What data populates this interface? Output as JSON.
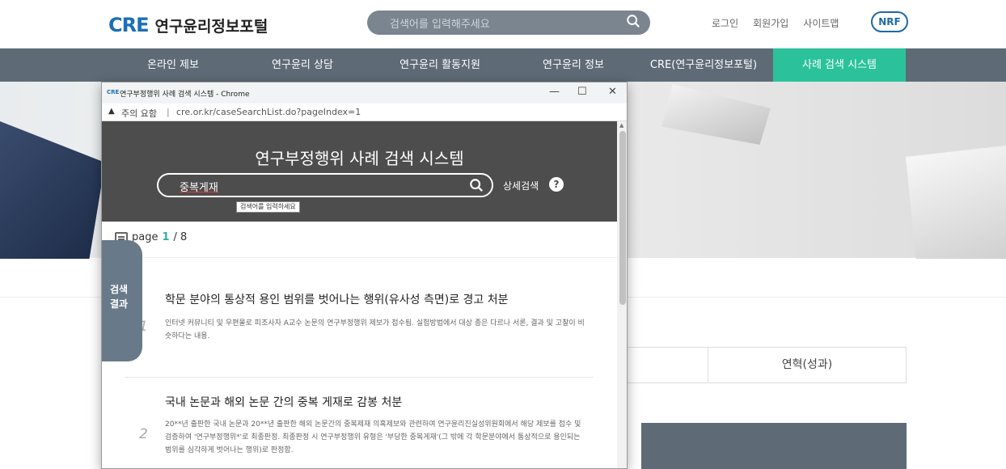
{
  "site": {
    "logo_mark": "CRE",
    "logo_text": "연구윤리정보포털",
    "search_placeholder": "검색어를 입력해주세요",
    "links": [
      "로그인",
      "회원가입",
      "사이트맵"
    ],
    "nrf_badge": "NRF"
  },
  "nav": {
    "items": [
      "온라인 제보",
      "연구윤리 상담",
      "연구윤리 활동지원",
      "연구윤리 정보",
      "CRE(연구윤리정보포털)",
      "사례 검색 시스템"
    ],
    "active_index": 5
  },
  "background": {
    "table_cell": "연혁(성과)"
  },
  "popup": {
    "window_title": "연구부정행위 사례 검색 시스템 - Chrome",
    "favicon_text": "CRE",
    "controls": [
      "—",
      "☐",
      "✕"
    ],
    "address": {
      "warning_icon": "▲",
      "warning_label": "주의 요함",
      "separator": "|",
      "url": "cre.or.kr/caseSearchList.do?pageIndex=1"
    },
    "header_title": "연구부정행위 사례 검색 시스템",
    "search_value": "중복게재",
    "search_tooltip": "검색어를 입력하세요",
    "advanced_search": "상세검색",
    "help_icon": "?",
    "page_label": "page",
    "page_current": "1",
    "page_total": "/ 8",
    "side_tab": [
      "검색",
      "결과"
    ],
    "results": [
      {
        "num": "1",
        "title": "학문 분야의 통상적 용인 범위를 벗어나는 행위(유사성 측면)로 경고 처분",
        "desc": "인터넷 커뮤니티 및 우편물로 피조사자 A교수 논문의 연구부정행위 제보가 접수됨. 실험방법에서 대상 종은 다르나 서론, 결과 및 고찰이 비슷하다는 내용."
      },
      {
        "num": "2",
        "title": "국내 논문과 해외 논문 간의 중복 게재로 감봉 처분",
        "desc": "20**년 출판한 국내 논문과 20**년 출판한 해외 논문간의 중복제재 의혹제보와 관련하여 연구윤리진실성위원회에서 해당 제보를 접수 및 검증하여 '연구부정행위*'로 최종판정. 최종판정 시 연구부정행위 유형은 '부당한 중복게재'(그 밖에 각 학문분야에서 통상적으로 용인되는 범위를 심각하게 벗어나는 행위)로 판정함."
      }
    ]
  },
  "colors": {
    "nav_bg": "#5e6b76",
    "nav_active": "#2bc29b",
    "popup_header": "#4d4d4d",
    "brand_blue": "#1c6fb5",
    "accent_teal": "#2bb3a0"
  }
}
